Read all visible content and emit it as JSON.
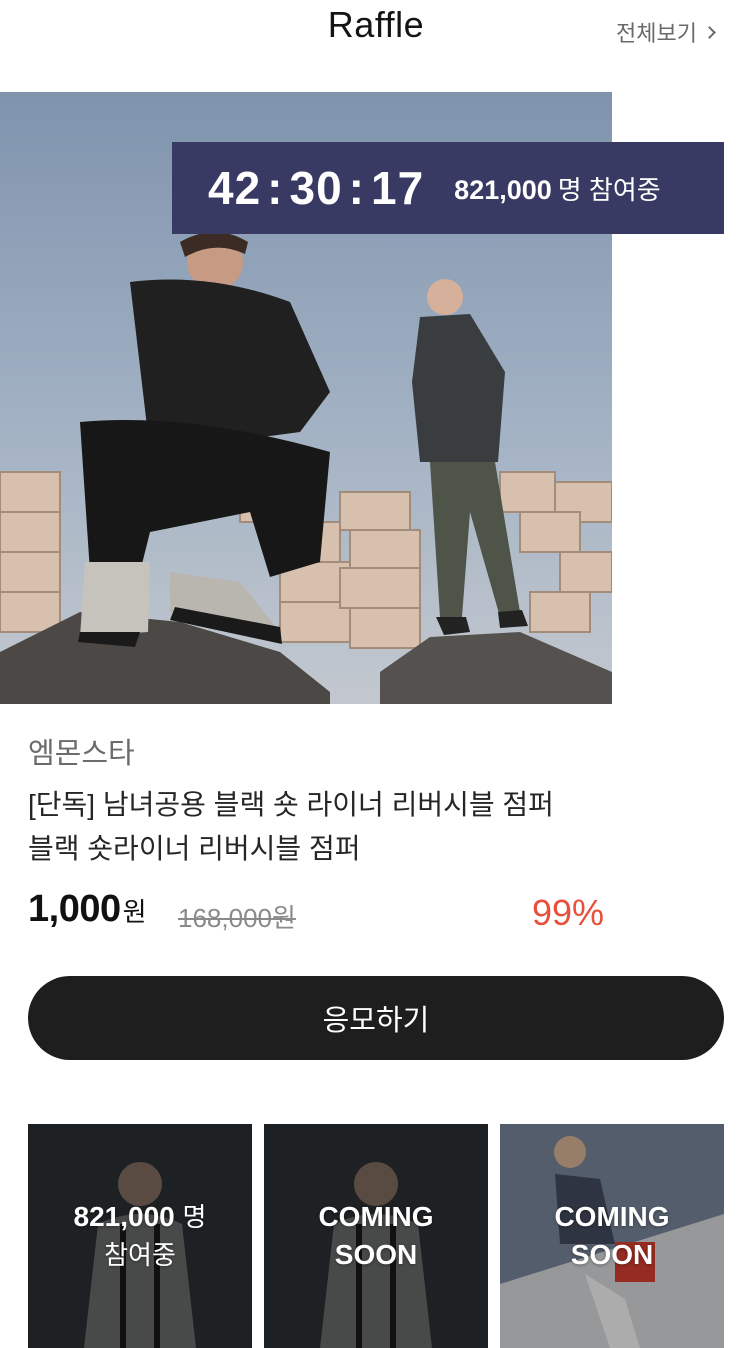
{
  "header": {
    "title": "Raffle",
    "view_all": "전체보기"
  },
  "raffle": {
    "timer": {
      "hours": "42",
      "minutes": "30",
      "seconds": "17"
    },
    "participants_count": "821,000",
    "participants_unit": "명 참여중"
  },
  "product": {
    "brand": "엠몬스타",
    "name_line1": "[단독] 남녀공용 블랙 숏 라이너 리버시블 점퍼",
    "name_line2": "블랙 숏라이너 리버시블 점퍼",
    "price": "1,000",
    "price_unit": "원",
    "original_price": "168,000원",
    "discount": "99%"
  },
  "apply_button": "응모하기",
  "thumbnails": [
    {
      "line1": "821,000",
      "line1_unit": "명",
      "line2": "참여중"
    },
    {
      "line1": "COMING",
      "line2": "SOON"
    },
    {
      "line1": "COMING",
      "line2": "SOON"
    }
  ],
  "colors": {
    "timer_bg": "#383a63",
    "discount": "#e8503c",
    "button_bg": "#1e1e1e"
  },
  "icons": {
    "view_all": "chevron-right-icon"
  }
}
